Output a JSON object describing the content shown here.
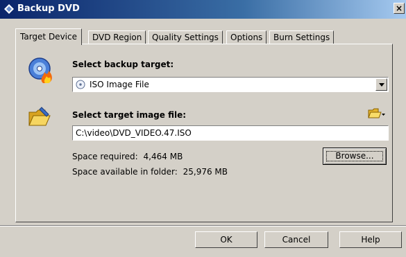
{
  "window": {
    "title": "Backup DVD",
    "close_label": "×"
  },
  "tabs": [
    {
      "label": "Target Device"
    },
    {
      "label": "DVD Region"
    },
    {
      "label": "Quality Settings"
    },
    {
      "label": "Options"
    },
    {
      "label": "Burn Settings"
    }
  ],
  "target": {
    "heading": "Select backup target:",
    "selected": "ISO Image File"
  },
  "image_file": {
    "heading": "Select target image file:",
    "path": "C:\\video\\DVD_VIDEO.47.ISO",
    "space_required_label": "Space required:",
    "space_required_value": "4,464 MB",
    "space_available_label": "Space available in folder:",
    "space_available_value": "25,976 MB",
    "browse_label": "Browse..."
  },
  "buttons": {
    "ok": "OK",
    "cancel": "Cancel",
    "help": "Help"
  },
  "colors": {
    "titlebar_start": "#0a246a",
    "titlebar_end": "#a6caf0",
    "face": "#d4d0c8"
  },
  "icons": [
    "app-icon",
    "close-icon",
    "dvd-fire-icon",
    "disc-icon",
    "chevron-down-icon",
    "folder-pen-icon",
    "folder-menu-icon"
  ]
}
